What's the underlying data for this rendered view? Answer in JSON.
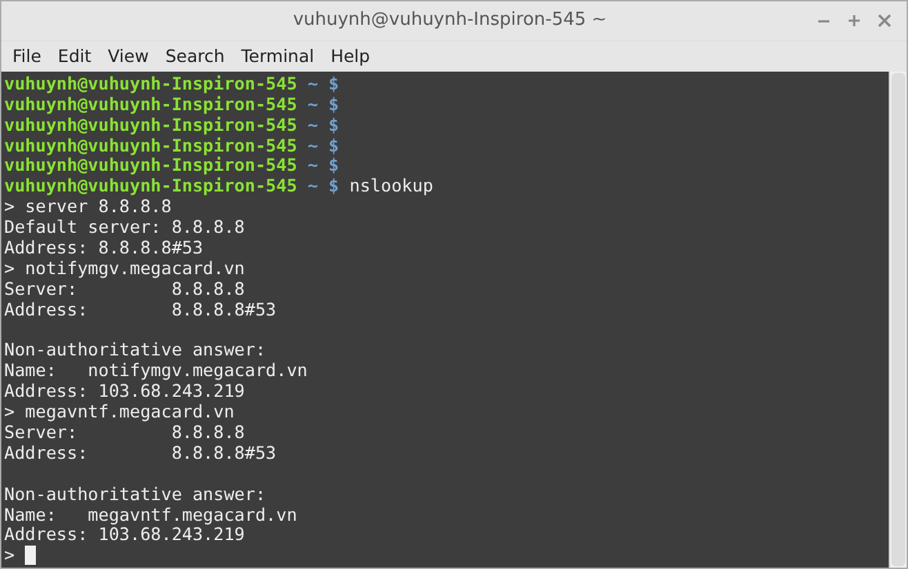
{
  "window": {
    "title": "vuhuynh@vuhuynh-Inspiron-545 ~"
  },
  "menu": [
    "File",
    "Edit",
    "View",
    "Search",
    "Terminal",
    "Help"
  ],
  "terminal": {
    "lines": [
      {
        "kind": "prompt",
        "user_host": "vuhuynh@vuhuynh-Inspiron-545",
        "path": "~",
        "symbol": "$"
      },
      {
        "kind": "prompt",
        "user_host": "vuhuynh@vuhuynh-Inspiron-545",
        "path": "~",
        "symbol": "$"
      },
      {
        "kind": "prompt",
        "user_host": "vuhuynh@vuhuynh-Inspiron-545",
        "path": "~",
        "symbol": "$"
      },
      {
        "kind": "prompt",
        "user_host": "vuhuynh@vuhuynh-Inspiron-545",
        "path": "~",
        "symbol": "$"
      },
      {
        "kind": "prompt",
        "user_host": "vuhuynh@vuhuynh-Inspiron-545",
        "path": "~",
        "symbol": "$"
      },
      {
        "kind": "prompt",
        "user_host": "vuhuynh@vuhuynh-Inspiron-545",
        "path": "~",
        "symbol": "$",
        "command": "nslookup"
      },
      {
        "kind": "output",
        "text": "> server 8.8.8.8"
      },
      {
        "kind": "output",
        "text": "Default server: 8.8.8.8"
      },
      {
        "kind": "output",
        "text": "Address: 8.8.8.8#53"
      },
      {
        "kind": "output",
        "text": "> notifymgv.megacard.vn"
      },
      {
        "kind": "output",
        "text": "Server:         8.8.8.8"
      },
      {
        "kind": "output",
        "text": "Address:        8.8.8.8#53"
      },
      {
        "kind": "blank"
      },
      {
        "kind": "output",
        "text": "Non-authoritative answer:"
      },
      {
        "kind": "output",
        "text": "Name:   notifymgv.megacard.vn"
      },
      {
        "kind": "output",
        "text": "Address: 103.68.243.219"
      },
      {
        "kind": "output",
        "text": "> megavntf.megacard.vn"
      },
      {
        "kind": "output",
        "text": "Server:         8.8.8.8"
      },
      {
        "kind": "output",
        "text": "Address:        8.8.8.8#53"
      },
      {
        "kind": "blank"
      },
      {
        "kind": "output",
        "text": "Non-authoritative answer:"
      },
      {
        "kind": "output",
        "text": "Name:   megavntf.megacard.vn"
      },
      {
        "kind": "output",
        "text": "Address: 103.68.243.219"
      },
      {
        "kind": "input",
        "text": ">",
        "cursor": true
      }
    ]
  }
}
